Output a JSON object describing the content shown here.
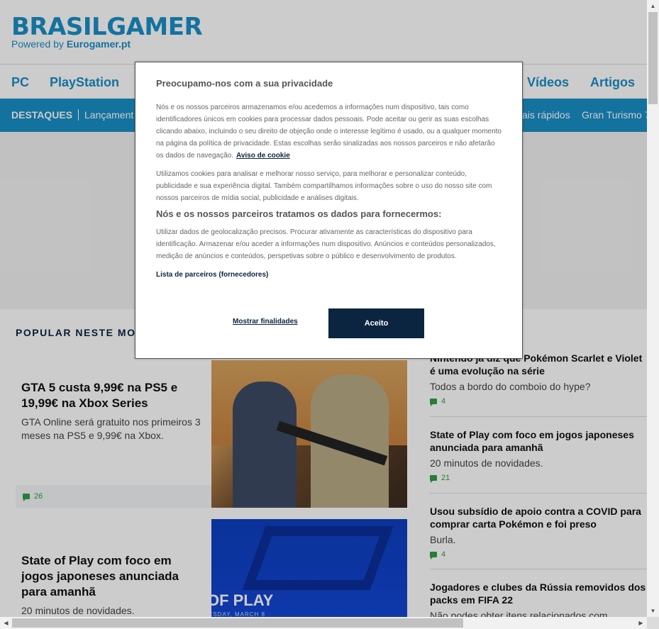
{
  "brand": {
    "logo": "BRASILGAMER",
    "powered_prefix": "Powered by",
    "powered_site": "Eurogamer.pt"
  },
  "nav": {
    "items": [
      "PC",
      "PlayStation",
      "Vídeos",
      "Artigos"
    ]
  },
  "subnav": {
    "destaques": "DESTAQUES",
    "items": [
      "Lançament",
      "ais rápidos",
      "Gran Turismo 7"
    ]
  },
  "popular": {
    "heading": "POPULAR NESTE MO"
  },
  "cards": [
    {
      "title": "GTA 5 custa 9,99€ na PS5 e 19,99€ na Xbox Series",
      "sub": "GTA Online será gratuito nos primeiros 3 meses na PS5 e 9,99€ na Xbox.",
      "comments": "26"
    },
    {
      "title": "State of Play com foco em jogos japoneses anunciada para amanhã",
      "sub": "20 minutos de novidades.",
      "image_text": "OF PLAY",
      "image_date": "ESDAY, MARCH 8"
    }
  ],
  "right_list": [
    {
      "title": "Nintendo já diz que Pokémon Scarlet e Violet é uma evolução na série",
      "sub": "Todos a bordo do comboio do hype?",
      "comments": "4"
    },
    {
      "title": "State of Play com foco em jogos japoneses anunciada para amanhã",
      "sub": "20 minutos de novidades.",
      "comments": "21"
    },
    {
      "title": "Usou subsídio de apoio contra a COVID para comprar carta Pokémon e foi preso",
      "sub": "Burla.",
      "comments": "4"
    },
    {
      "title": "Jogadores e clubes da Rússia removidos dos packs em FIFA 22",
      "sub": "Não podes obter itens relacionados com"
    }
  ],
  "modal": {
    "title": "Preocupamo-nos com a sua privacidade",
    "p1": "Nós e os nossos parceiros armazenamos e/ou acedemos a informações num dispositivo, tais como identificadores únicos em cookies para processar dados pessoais. Pode aceitar ou gerir as suas escolhas clicando abaixo, incluindo o seu direito de objeção onde o interesse legítimo é usado, ou a qualquer momento na página da política de privacidade. Estas escolhas serão sinalizadas aos nossos parceiros e não afetarão os dados de navegação.",
    "cookie_link": "Aviso de cookie",
    "p2": "Utilizamos cookies para analisar e melhorar nosso serviço, para melhorar e personalizar conteúdo, publicidade e sua experiência digital. Também compartilhamos informações sobre o uso do nosso site com nossos parceiros de mídia social, publicidade e análises digitais.",
    "subtitle": "Nós e os nossos parceiros tratamos os dados para fornecermos:",
    "p3": "Utilizar dados de geolocalização precisos. Procurar ativamente as características do dispositivo para identificação. Armazenar e/ou aceder a informações num dispositivo. Anúncios e conteúdos personalizados, medição de anúncios e conteúdos, perspetivas sobre o público e desenvolvimento de produtos.",
    "partners_link": "Lista de parceiros (fornecedores)",
    "show_button": "Mostrar finalidades",
    "accept_button": "Aceito"
  },
  "colors": {
    "brand": "#1a8fc7",
    "dark": "#0b2540",
    "comment": "#2f9e44"
  }
}
